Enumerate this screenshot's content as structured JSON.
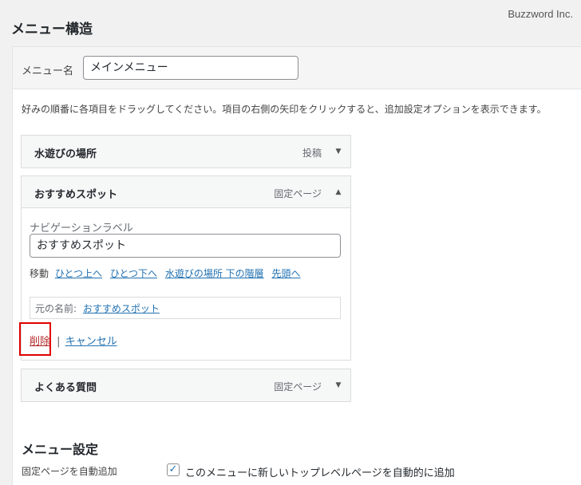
{
  "watermark": "Buzzword Inc.",
  "page_title": "メニュー構造",
  "menu_name": {
    "label": "メニュー名",
    "value": "メインメニュー"
  },
  "instructions": "好みの順番に各項目をドラッグしてください。項目の右側の矢印をクリックすると、追加設定オプションを表示できます。",
  "items": [
    {
      "title": "水遊びの場所",
      "type": "投稿",
      "toggle": "▼"
    },
    {
      "title": "おすすめスポット",
      "type": "固定ページ",
      "toggle": "▲"
    },
    {
      "title": "よくある質問",
      "type": "固定ページ",
      "toggle": "▼"
    }
  ],
  "expanded": {
    "nav_label_title": "ナビゲーションラベル",
    "nav_label_value": "おすすめスポット",
    "move_label": "移動",
    "move_links": [
      "ひとつ上へ",
      "ひとつ下へ",
      "水遊びの場所 下の階層",
      "先頭へ"
    ],
    "original_label": "元の名前:",
    "original_link": "おすすめスポット",
    "delete_label": "削除",
    "separator": "|",
    "cancel_label": "キャンセル"
  },
  "settings": {
    "title": "メニュー設定",
    "auto_add_label": "固定ページを自動追加",
    "checkbox_checked": true,
    "checkbox_mark": "✓",
    "checkbox_label": "このメニューに新しいトップレベルページを自動的に追加"
  },
  "colors": {
    "link": "#2271b1",
    "delete": "#b32d2e",
    "highlight": "#e00000"
  }
}
